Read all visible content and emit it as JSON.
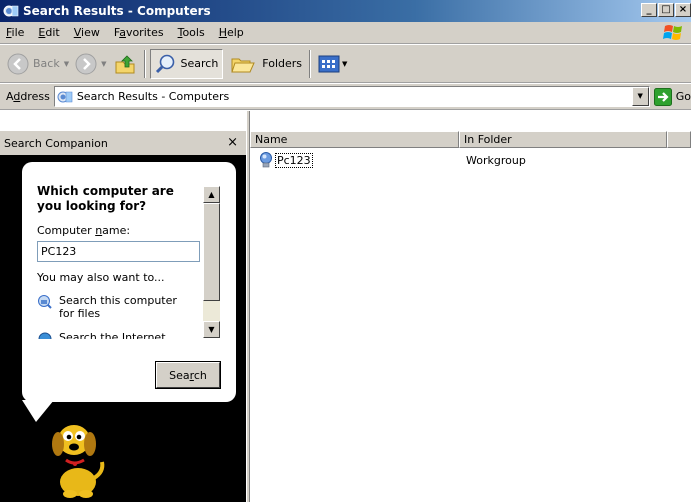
{
  "window": {
    "title": "Search Results - Computers",
    "controls": [
      "_",
      "□",
      "×"
    ]
  },
  "menu": {
    "items": [
      {
        "label": "File",
        "accel": "F",
        "rest": "ile"
      },
      {
        "label": "Edit",
        "accel": "E",
        "rest": "dit"
      },
      {
        "label": "View",
        "accel": "V",
        "rest": "iew"
      },
      {
        "label": "Favorites",
        "pre": "F",
        "accel": "a",
        "rest": "vorites"
      },
      {
        "label": "Tools",
        "accel": "T",
        "rest": "ools"
      },
      {
        "label": "Help",
        "accel": "H",
        "rest": "elp"
      }
    ]
  },
  "toolbar": {
    "back": "Back",
    "search": "Search",
    "folders": "Folders"
  },
  "address": {
    "label_pre": "A",
    "label_accel": "d",
    "label_rest": "dress",
    "value": "Search Results - Computers",
    "go": "Go"
  },
  "search_companion": {
    "header": "Search Companion",
    "close": "×",
    "question": "Which computer are you looking for?",
    "computer_name_label_pre": "Computer ",
    "computer_name_label_accel": "n",
    "computer_name_label_rest": "ame:",
    "computer_name_value": "PC123",
    "also": "You may also want to...",
    "option1": "Search this computer for files",
    "option2": "Search the Internet",
    "search_button_pre": "Sea",
    "search_button_accel": "r",
    "search_button_rest": "ch"
  },
  "results": {
    "columns": [
      "Name",
      "In Folder"
    ],
    "rows": [
      {
        "name": "Pc123",
        "folder": "Workgroup"
      }
    ]
  },
  "colors": {
    "title_bar": "#0a246a",
    "chrome": "#d4d0c8",
    "companion_bg": "#000000",
    "dog_body": "#f0c020"
  }
}
